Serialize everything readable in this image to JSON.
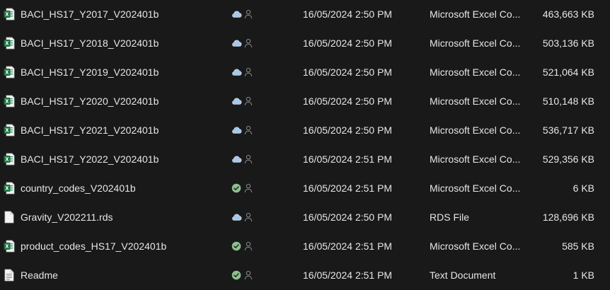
{
  "files": [
    {
      "name": "BACI_HS17_Y2017_V202401b",
      "kind": "excel",
      "status": "cloud-icon",
      "date": "16/05/2024 2:50 PM",
      "type": "Microsoft Excel Co...",
      "size": "463,663 KB"
    },
    {
      "name": "BACI_HS17_Y2018_V202401b",
      "kind": "excel",
      "status": "cloud-icon",
      "date": "16/05/2024 2:50 PM",
      "type": "Microsoft Excel Co...",
      "size": "503,136 KB"
    },
    {
      "name": "BACI_HS17_Y2019_V202401b",
      "kind": "excel",
      "status": "cloud-icon",
      "date": "16/05/2024 2:50 PM",
      "type": "Microsoft Excel Co...",
      "size": "521,064 KB"
    },
    {
      "name": "BACI_HS17_Y2020_V202401b",
      "kind": "excel",
      "status": "cloud-icon",
      "date": "16/05/2024 2:50 PM",
      "type": "Microsoft Excel Co...",
      "size": "510,148 KB"
    },
    {
      "name": "BACI_HS17_Y2021_V202401b",
      "kind": "excel",
      "status": "cloud-icon",
      "date": "16/05/2024 2:50 PM",
      "type": "Microsoft Excel Co...",
      "size": "536,717 KB"
    },
    {
      "name": "BACI_HS17_Y2022_V202401b",
      "kind": "excel",
      "status": "cloud-icon",
      "date": "16/05/2024 2:51 PM",
      "type": "Microsoft Excel Co...",
      "size": "529,356 KB"
    },
    {
      "name": "country_codes_V202401b",
      "kind": "excel",
      "status": "check-icon",
      "date": "16/05/2024 2:51 PM",
      "type": "Microsoft Excel Co...",
      "size": "6 KB"
    },
    {
      "name": "Gravity_V202211.rds",
      "kind": "blank",
      "status": "cloud-icon",
      "date": "16/05/2024 2:50 PM",
      "type": "RDS File",
      "size": "128,696 KB"
    },
    {
      "name": "product_codes_HS17_V202401b",
      "kind": "excel",
      "status": "check-icon",
      "date": "16/05/2024 2:51 PM",
      "type": "Microsoft Excel Co...",
      "size": "585 KB"
    },
    {
      "name": "Readme",
      "kind": "text",
      "status": "check-icon",
      "date": "16/05/2024 2:51 PM",
      "type": "Text Document",
      "size": "1 KB"
    }
  ],
  "colors": {
    "background": "#191919",
    "text": "#e6e6e6",
    "excel_green": "#1d6f42",
    "cloud_blue": "#a9c7e8",
    "check_green": "#8fbf8f"
  }
}
